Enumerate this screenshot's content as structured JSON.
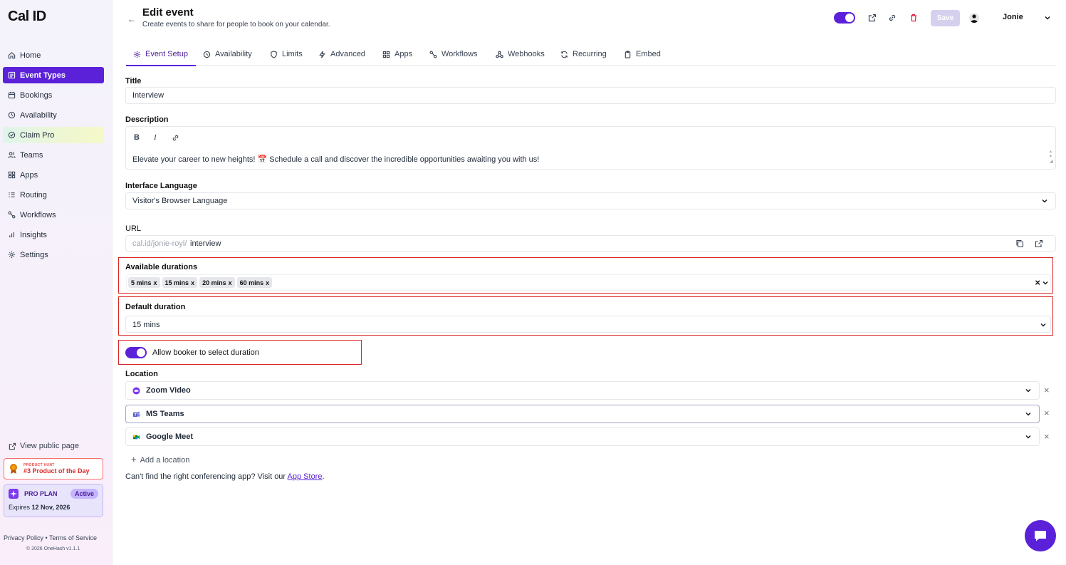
{
  "brand": {
    "logo_text": "Cal ID"
  },
  "sidebar": {
    "items": [
      {
        "label": "Home",
        "icon": "home-icon"
      },
      {
        "label": "Event Types",
        "icon": "event-types-icon"
      },
      {
        "label": "Bookings",
        "icon": "calendar-icon"
      },
      {
        "label": "Availability",
        "icon": "clock-icon"
      },
      {
        "label": "Claim Pro",
        "icon": "badge-icon"
      },
      {
        "label": "Teams",
        "icon": "users-icon"
      },
      {
        "label": "Apps",
        "icon": "grid-icon"
      },
      {
        "label": "Routing",
        "icon": "routing-icon"
      },
      {
        "label": "Workflows",
        "icon": "workflow-icon"
      },
      {
        "label": "Insights",
        "icon": "bar-chart-icon"
      },
      {
        "label": "Settings",
        "icon": "gear-icon"
      }
    ],
    "view_public_page": "View public page",
    "product_hunt": {
      "small": "PRODUCT HUNT",
      "big": "#3 Product of the Day"
    },
    "plan": {
      "name": "PRO PLAN",
      "status": "Active",
      "expires_label": "Expires",
      "expires_date": "12 Nov, 2026"
    },
    "footer": {
      "privacy": "Privacy Policy",
      "sep": "•",
      "terms": "Terms of Service",
      "copyright": "© 2026 OneHash v1.1.1"
    }
  },
  "header": {
    "title": "Edit event",
    "subtitle": "Create events to share for people to book on your calendar.",
    "save_label": "Save",
    "user_name": "Jonie"
  },
  "tabs": [
    {
      "label": "Event Setup",
      "icon": "gear-icon"
    },
    {
      "label": "Availability",
      "icon": "clock-icon"
    },
    {
      "label": "Limits",
      "icon": "shield-icon"
    },
    {
      "label": "Advanced",
      "icon": "lightning-icon"
    },
    {
      "label": "Apps",
      "icon": "grid-icon"
    },
    {
      "label": "Workflows",
      "icon": "workflow-icon"
    },
    {
      "label": "Webhooks",
      "icon": "webhook-icon"
    },
    {
      "label": "Recurring",
      "icon": "refresh-icon"
    },
    {
      "label": "Embed",
      "icon": "clipboard-icon"
    }
  ],
  "form": {
    "title_label": "Title",
    "title_value": "Interview",
    "description_label": "Description",
    "description_value": "Elevate your career to new heights! 📅 Schedule a call and discover the incredible opportunities awaiting you with us!",
    "language_label": "Interface Language",
    "language_value": "Visitor's Browser Language",
    "url_label": "URL",
    "url_prefix": "cal.id/jonie-royl/",
    "url_slug": "interview",
    "durations_label": "Available durations",
    "durations": [
      "5 mins",
      "15 mins",
      "20 mins",
      "60 mins"
    ],
    "chip_remove": "x",
    "default_duration_label": "Default duration",
    "default_duration_value": "15 mins",
    "allow_select_label": "Allow booker to select duration",
    "location_label": "Location",
    "locations": [
      "Zoom Video",
      "MS Teams",
      "Google Meet"
    ],
    "add_location": "Add a location",
    "cant_find_prefix": "Can't find the right conferencing app? Visit our ",
    "cant_find_link": "App Store",
    "cant_find_suffix": "."
  },
  "colors": {
    "accent": "#5b21d9",
    "highlight": "#dc2626"
  }
}
